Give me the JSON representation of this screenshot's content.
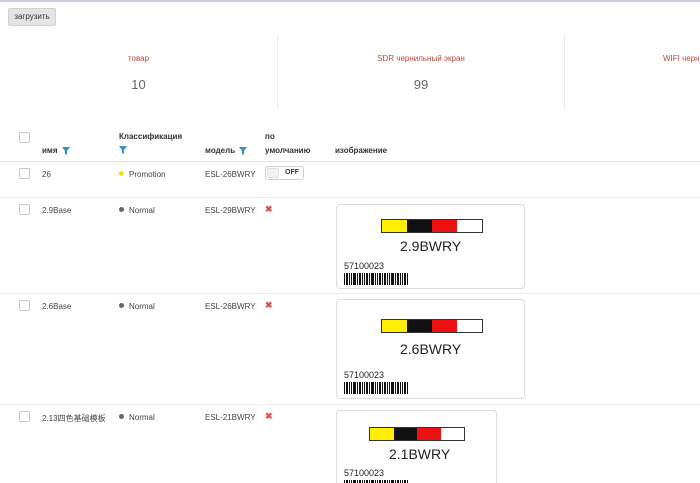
{
  "toolbar": {
    "upload_label": "загрузить"
  },
  "stats": [
    {
      "label": "товар",
      "value": "10"
    },
    {
      "label": "SDR чернильный экран",
      "value": "99"
    },
    {
      "label": "WIFI черн",
      "value": ""
    }
  ],
  "table": {
    "headers": {
      "name": "имя",
      "classification": "Классификация",
      "model": "модель",
      "default_line1": "по",
      "default_line2": "умолчанию",
      "image": "изображение"
    },
    "rows": [
      {
        "name": "26",
        "classification": "Promotion",
        "class_color": "#f2e600",
        "model": "ESL-26BWRY",
        "default": "toggle",
        "toggle_label": "OFF",
        "image": null
      },
      {
        "name": "2.9Base",
        "classification": "Normal",
        "class_color": "#666666",
        "model": "ESL-29BWRY",
        "default": "cross",
        "image": {
          "model_text": "2.9BWRY",
          "code": "57100023"
        }
      },
      {
        "name": "2.6Base",
        "classification": "Normal",
        "class_color": "#666666",
        "model": "ESL-26BWRY",
        "default": "cross",
        "image": {
          "model_text": "2.6BWRY",
          "code": "57100023"
        }
      },
      {
        "name": "2.13四色基础模板",
        "classification": "Normal",
        "class_color": "#666666",
        "model": "ESL-21BWRY",
        "default": "cross",
        "image": {
          "model_text": "2.1BWRY",
          "code": "57100023"
        }
      }
    ]
  },
  "colors": {
    "yellow": "#ffee00",
    "black": "#111111",
    "red": "#ee1111",
    "white": "#ffffff",
    "filter": "#3a8fc7",
    "accent_label": "#b54a3c"
  },
  "icons": {
    "filter": "filter-icon",
    "cross": "close-icon"
  }
}
